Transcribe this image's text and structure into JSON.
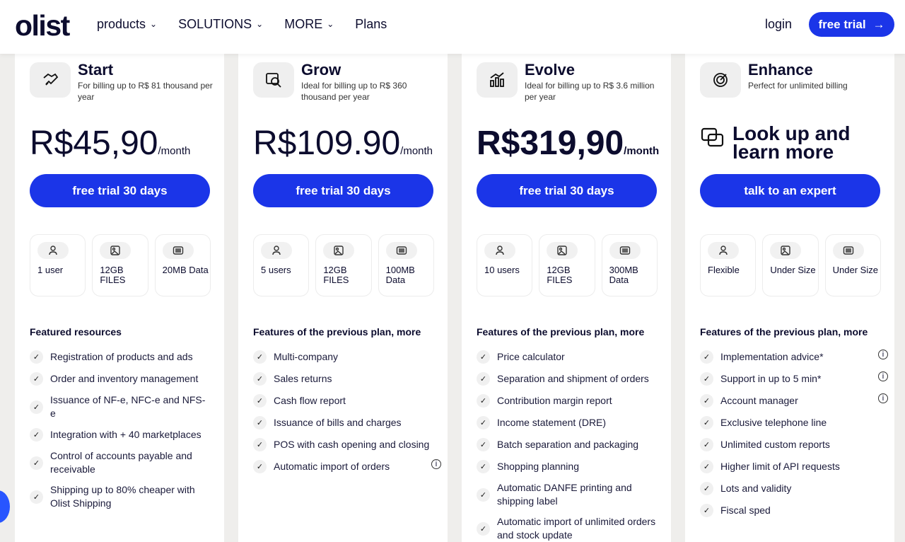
{
  "header": {
    "logo": "olist",
    "nav": [
      {
        "label": "products",
        "has_dropdown": true
      },
      {
        "label": "SOLUTIONS",
        "has_dropdown": true
      },
      {
        "label": "MORE",
        "has_dropdown": true
      },
      {
        "label": "Plans",
        "has_dropdown": false
      }
    ],
    "login": "login",
    "cta": "free trial",
    "cta_icon": "arrow-right-icon"
  },
  "colors": {
    "accent": "#1b35e8",
    "text": "#0c0c2e",
    "background": "#efeeec"
  },
  "plans": [
    {
      "name": "Start",
      "subtitle": "For billing up to R$ 81 thousand per year",
      "icon": "handshake-icon",
      "price_prefix": "R$45,90",
      "price_suffix": "/month",
      "button": "free trial 30 days",
      "resources": [
        {
          "icon": "user-icon",
          "text": "1 user"
        },
        {
          "icon": "image-icon",
          "text": "12GB FILES"
        },
        {
          "icon": "database-icon",
          "text": "20MB Data"
        }
      ],
      "features_title": "Featured resources",
      "features": [
        {
          "text": "Registration of products and ads",
          "info": false
        },
        {
          "text": "Order and inventory management",
          "info": false
        },
        {
          "text": "Issuance of NF-e, NFC-e and NFS-e",
          "info": false
        },
        {
          "text": "Integration with + 40 marketplaces",
          "info": false
        },
        {
          "text": "Control of accounts payable and receivable",
          "info": false
        },
        {
          "text": "Shipping up to 80% cheaper with Olist Shipping",
          "info": false
        }
      ]
    },
    {
      "name": "Grow",
      "subtitle": "Ideal for billing up to R$ 360 thousand per year",
      "icon": "search-icon",
      "price_prefix": "R$109.90",
      "price_suffix": "/month",
      "button": "free trial 30 days",
      "resources": [
        {
          "icon": "user-icon",
          "text": "5 users"
        },
        {
          "icon": "image-icon",
          "text": "12GB FILES"
        },
        {
          "icon": "database-icon",
          "text": "100MB Data"
        }
      ],
      "features_title": "Features of the previous plan, more",
      "features": [
        {
          "text": "Multi-company",
          "info": false
        },
        {
          "text": "Sales returns",
          "info": false
        },
        {
          "text": "Cash flow report",
          "info": false
        },
        {
          "text": "Issuance of bills and charges",
          "info": false
        },
        {
          "text": "POS with cash opening and closing",
          "info": false
        },
        {
          "text": "Automatic import of orders",
          "info": true
        }
      ]
    },
    {
      "name": "Evolve",
      "subtitle": "Ideal for billing up to R$ 3.6 million per year",
      "icon": "chart-icon",
      "price_prefix": "R$319,90",
      "price_suffix": "/month",
      "button": "free trial 30 days",
      "resources": [
        {
          "icon": "user-icon",
          "text": "10 users"
        },
        {
          "icon": "image-icon",
          "text": "12GB FILES"
        },
        {
          "icon": "database-icon",
          "text": "300MB Data"
        }
      ],
      "features_title": "Features of the previous plan, more",
      "features": [
        {
          "text": "Price calculator",
          "info": false
        },
        {
          "text": "Separation and shipment of orders",
          "info": false
        },
        {
          "text": "Contribution margin report",
          "info": false
        },
        {
          "text": "Income statement (DRE)",
          "info": false
        },
        {
          "text": "Batch separation and packaging",
          "info": false
        },
        {
          "text": "Shopping planning",
          "info": false
        },
        {
          "text": "Automatic DANFE printing and shipping label",
          "info": false
        },
        {
          "text": "Automatic import of unlimited orders and stock update",
          "info": false
        }
      ]
    },
    {
      "name": "Enhance",
      "subtitle": "Perfect for unlimited billing",
      "icon": "target-icon",
      "look_text": "Look up and learn more",
      "button": "talk to an expert",
      "resources": [
        {
          "icon": "user-icon",
          "text": "Flexible"
        },
        {
          "icon": "image-icon",
          "text": "Under Size"
        },
        {
          "icon": "database-icon",
          "text": "Under Size"
        }
      ],
      "features_title": "Features of the previous plan, more",
      "features": [
        {
          "text": "Implementation advice*",
          "info": true
        },
        {
          "text": "Support in up to 5 min*",
          "info": true
        },
        {
          "text": "Account manager",
          "info": true
        },
        {
          "text": "Exclusive telephone line",
          "info": false
        },
        {
          "text": "Unlimited custom reports",
          "info": false
        },
        {
          "text": "Higher limit of API requests",
          "info": false
        },
        {
          "text": "Lots and validity",
          "info": false
        },
        {
          "text": "Fiscal sped",
          "info": false
        }
      ]
    }
  ]
}
